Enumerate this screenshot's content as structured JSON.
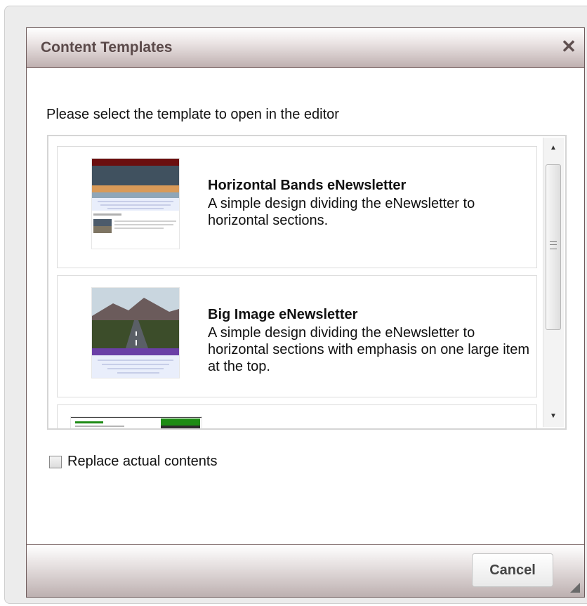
{
  "dialog": {
    "title": "Content Templates",
    "close_icon": "close-icon"
  },
  "instruction": "Please select the template to open in the editor",
  "templates": [
    {
      "title": "Horizontal Bands eNewsletter",
      "description": "A simple design dividing the eNewsletter to horizontal sections."
    },
    {
      "title": "Big Image eNewsletter",
      "description": "A simple design dividing the eNewsletter to horizontal sections with emphasis on one large item at the top."
    }
  ],
  "replace_label": "Replace actual contents",
  "replace_checked": false,
  "cancel_label": "Cancel",
  "colors": {
    "title_text": "#5b4a4a",
    "titlebar_top": "#ffffff",
    "titlebar_bottom": "#bfb0b0",
    "green_accent": "#1d8b14",
    "purple_band": "#6a3fa6"
  }
}
